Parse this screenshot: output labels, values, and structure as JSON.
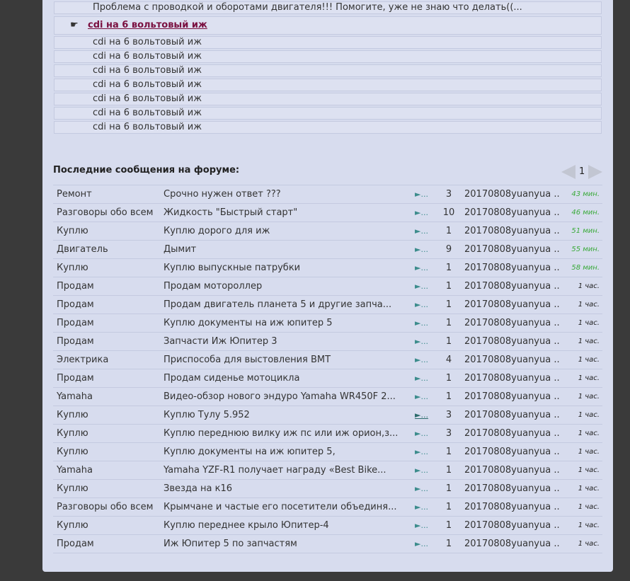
{
  "threads": {
    "top_row": "Проблема с проводкой и оборотами двигателя!!! Помогите, уже не знаю что делать((...",
    "active_title": "cdi на 6 вольтовый иж",
    "replies": [
      "cdi на 6 вольтовый иж",
      "cdi на 6 вольтовый иж",
      "cdi на 6 вольтовый иж",
      "cdi на 6 вольтовый иж",
      "cdi на 6 вольтовый иж",
      "cdi на 6 вольтовый иж",
      "cdi на 6 вольтовый иж"
    ]
  },
  "latest": {
    "title": "Последние сообщения на форуме:",
    "page": "1",
    "rows": [
      {
        "category": "Ремонт",
        "topic": "Срочно нужен ответ ???",
        "go": "►...",
        "count": "3",
        "author": "20170808yuanyua ..",
        "time": "43 мин.",
        "recent": true
      },
      {
        "category": "Разговоры обо всем",
        "topic": "Жидкость \"Быстрый старт\"",
        "go": "►...",
        "count": "10",
        "author": "20170808yuanyua ..",
        "time": "46 мин.",
        "recent": true
      },
      {
        "category": "Куплю",
        "topic": "Куплю дорого для иж",
        "go": "►...",
        "count": "1",
        "author": "20170808yuanyua ..",
        "time": "51 мин.",
        "recent": true
      },
      {
        "category": "Двигатель",
        "topic": "Дымит",
        "go": "►...",
        "count": "9",
        "author": "20170808yuanyua ..",
        "time": "55 мин.",
        "recent": true
      },
      {
        "category": "Куплю",
        "topic": "Куплю выпускные патрубки",
        "go": "►...",
        "count": "1",
        "author": "20170808yuanyua ..",
        "time": "58 мин.",
        "recent": true
      },
      {
        "category": "Продам",
        "topic": "Продам мотороллер",
        "go": "►...",
        "count": "1",
        "author": "20170808yuanyua ..",
        "time": "1 час.",
        "recent": false
      },
      {
        "category": "Продам",
        "topic": "Продам двигатель планета 5 и другие запча...",
        "go": "►...",
        "count": "1",
        "author": "20170808yuanyua ..",
        "time": "1 час.",
        "recent": false
      },
      {
        "category": "Продам",
        "topic": "Куплю документы на иж юпитер 5",
        "go": "►...",
        "count": "1",
        "author": "20170808yuanyua ..",
        "time": "1 час.",
        "recent": false
      },
      {
        "category": "Продам",
        "topic": "Запчасти Иж Юпитер 3",
        "go": "►...",
        "count": "1",
        "author": "20170808yuanyua ..",
        "time": "1 час.",
        "recent": false
      },
      {
        "category": "Электрика",
        "topic": "Приспособа для выстовления ВМТ",
        "go": "►...",
        "count": "4",
        "author": "20170808yuanyua ..",
        "time": "1 час.",
        "recent": false
      },
      {
        "category": "Продам",
        "topic": "Продам сиденье мотоцикла",
        "go": "►...",
        "count": "1",
        "author": "20170808yuanyua ..",
        "time": "1 час.",
        "recent": false
      },
      {
        "category": "Yamaha",
        "topic": "Видео-обзор нового эндуро Yamaha WR450F 2...",
        "go": "►...",
        "count": "1",
        "author": "20170808yuanyua ..",
        "time": "1 час.",
        "recent": false
      },
      {
        "category": "Куплю",
        "topic": "Куплю Тулу 5.952",
        "go": "►...",
        "count": "3",
        "author": "20170808yuanyua ..",
        "time": "1 час.",
        "recent": false,
        "underline": true
      },
      {
        "category": "Куплю",
        "topic": "Куплю переднюю вилку иж пс или иж орион,з...",
        "go": "►...",
        "count": "3",
        "author": "20170808yuanyua ..",
        "time": "1 час.",
        "recent": false
      },
      {
        "category": "Куплю",
        "topic": "Куплю документы на иж юпитер 5,",
        "go": "►...",
        "count": "1",
        "author": "20170808yuanyua ..",
        "time": "1 час.",
        "recent": false
      },
      {
        "category": "Yamaha",
        "topic": "Yamaha YZF-R1 получает награду «Best Bike...",
        "go": "►...",
        "count": "1",
        "author": "20170808yuanyua ..",
        "time": "1 час.",
        "recent": false
      },
      {
        "category": "Куплю",
        "topic": "Звезда на к16",
        "go": "►...",
        "count": "1",
        "author": "20170808yuanyua ..",
        "time": "1 час.",
        "recent": false
      },
      {
        "category": "Разговоры обо всем",
        "topic": "Крымчане и частые его посетители объединя...",
        "go": "►...",
        "count": "1",
        "author": "20170808yuanyua ..",
        "time": "1 час.",
        "recent": false
      },
      {
        "category": "Куплю",
        "topic": "Куплю переднее крыло Юпитер-4",
        "go": "►...",
        "count": "1",
        "author": "20170808yuanyua ..",
        "time": "1 час.",
        "recent": false
      },
      {
        "category": "Продам",
        "topic": "Иж Юпитер 5 по запчастям",
        "go": "►...",
        "count": "1",
        "author": "20170808yuanyua ..",
        "time": "1 час.",
        "recent": false
      }
    ]
  }
}
